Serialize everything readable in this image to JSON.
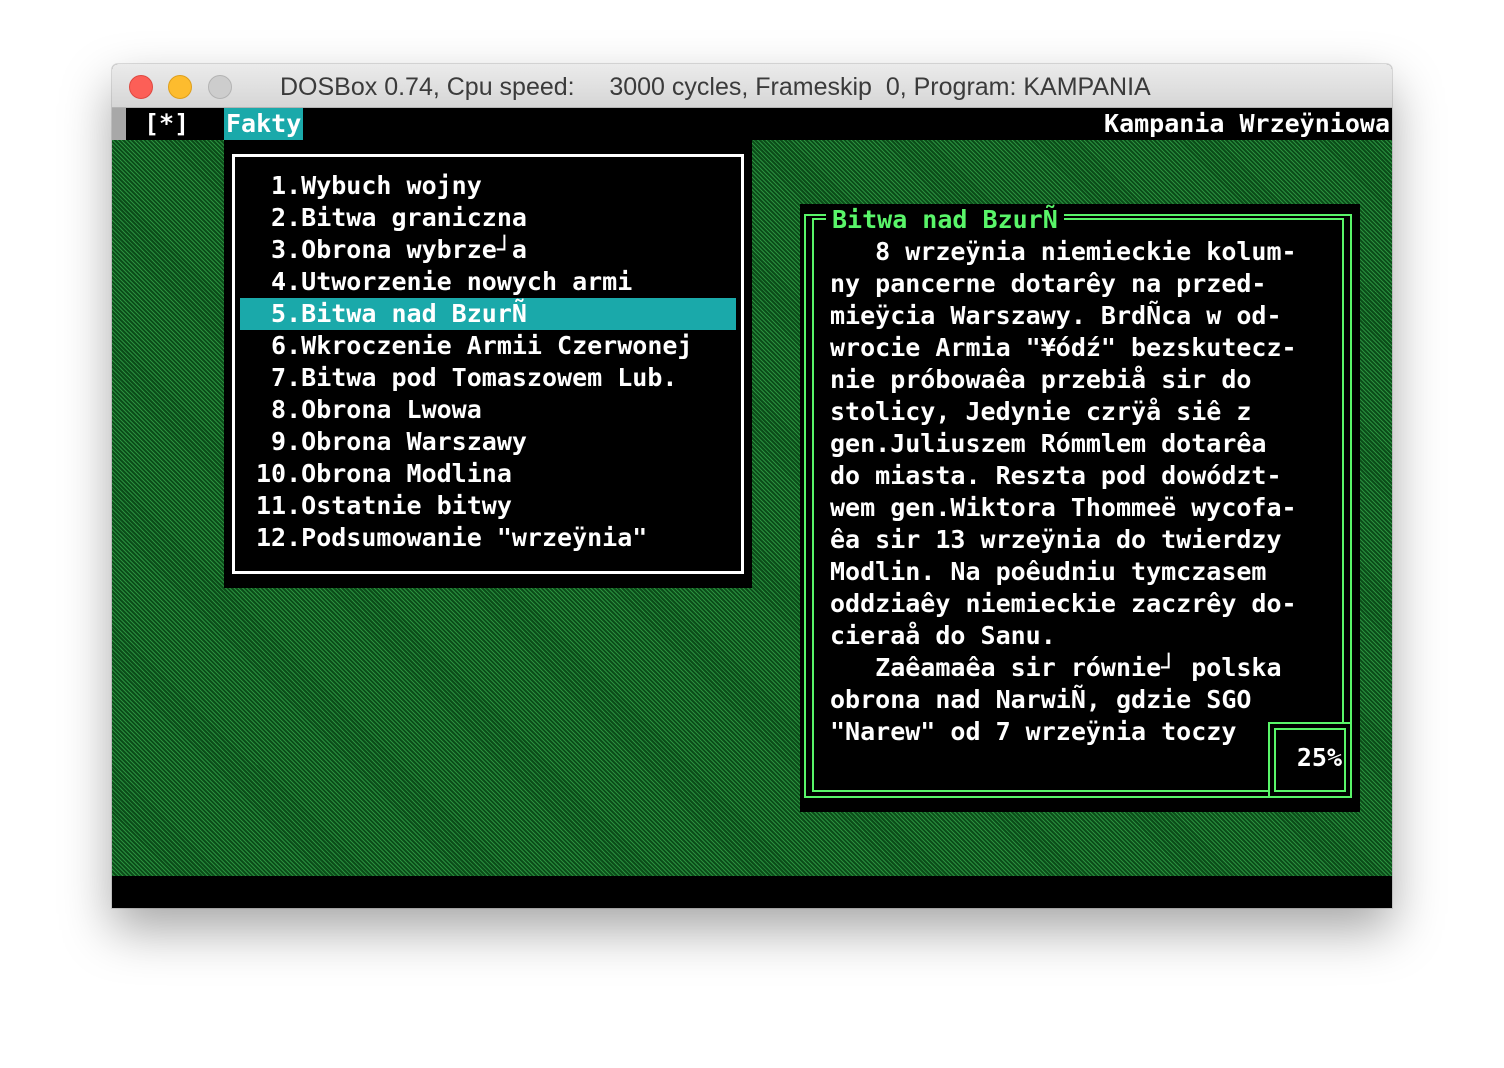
{
  "window": {
    "title": "DOSBox 0.74, Cpu speed:     3000 cycles, Frameskip  0, Program: KAMPANIA"
  },
  "menubar": {
    "system_label": "[*]",
    "active_menu": "Fakty",
    "app_title": "Kampania Wrzeÿniowa"
  },
  "menu": {
    "selected_index": 4,
    "items": [
      " 1.Wybuch wojny",
      " 2.Bitwa graniczna",
      " 3.Obrona wybrze┘a",
      " 4.Utworzenie nowych armi",
      " 5.Bitwa nad BzurÑ",
      " 6.Wkroczenie Armii Czerwonej",
      " 7.Bitwa pod Tomaszowem Lub.",
      " 8.Obrona Lwowa",
      " 9.Obrona Warszawy",
      "10.Obrona Modlina",
      "11.Ostatnie bitwy",
      "12.Podsumowanie \"wrzeÿnia\""
    ]
  },
  "article": {
    "title": "Bitwa nad BzurÑ",
    "lines": [
      "   8 wrzeÿnia niemieckie kolum-",
      "ny pancerne dotarêy na przed-",
      "mieÿcia Warszawy. BrdÑca w od-",
      "wrocie Armia \"¥ódź\" bezskutecz-",
      "nie próbowaêa przebiå sir do",
      "stolicy, Jedynie czrÿå siê z",
      "gen.Juliuszem Rómmlem dotarêa",
      "do miasta. Reszta pod dowództ-",
      "wem gen.Wiktora Thommeë wycofa-",
      "êa sir 13 wrzeÿnia do twierdzy",
      "Modlin. Na poêudniu tymczasem",
      "oddziaêy niemieckie zaczrêy do-",
      "cieraå do Sanu.",
      "   Zaêamaêa sir równie┘ polska",
      "obrona nad NarwiÑ, gdzie SGO",
      "\"Narew\" od 7 wrzeÿnia toczy"
    ],
    "progress_label": "25%"
  },
  "colors": {
    "accent": "#1aa9aa",
    "frame": "#59f569",
    "background_pattern": "#0f6b24"
  }
}
